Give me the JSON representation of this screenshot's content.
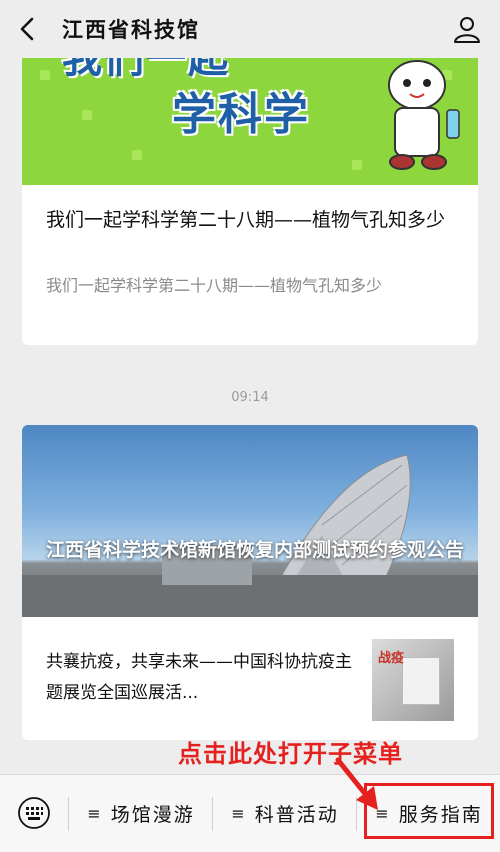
{
  "header": {
    "title": "江西省科技馆",
    "back_icon": "back-arrow-icon",
    "profile_icon": "person-icon"
  },
  "card1": {
    "banner_text_top": "我们一起",
    "banner_text": "学科学",
    "title": "我们一起学科学第二十八期——植物气孔知多少",
    "subtitle": "我们一起学科学第二十八期——植物气孔知多少"
  },
  "timestamp": "09:14",
  "card2": {
    "banner_overlay": "江西省科学技术馆新馆恢复内部测试预约参观公告",
    "item_text": "共襄抗疫，共享未来——中国科协抗疫主题展览全国巡展活...",
    "thumb_label": "战疫"
  },
  "annotation": {
    "text": "点击此处打开子菜单",
    "color": "#e52120"
  },
  "bottom_menu": {
    "keyboard_icon": "keyboard-icon",
    "items": [
      {
        "label": "场馆漫游"
      },
      {
        "label": "科普活动"
      },
      {
        "label": "服务指南"
      }
    ]
  }
}
